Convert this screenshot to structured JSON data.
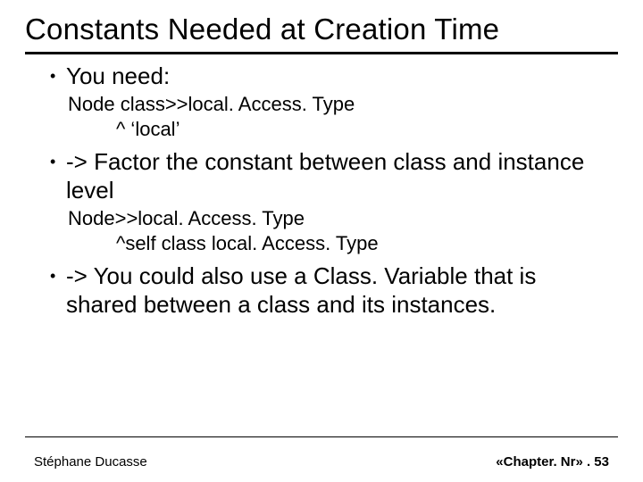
{
  "title": "Constants Needed at Creation Time",
  "bullets": {
    "b1": "You need:",
    "code1_l1": "Node class>>local. Access. Type",
    "code1_l2": "^ ‘local’",
    "b2": "-> Factor the constant between class and instance level",
    "code2_l1": "Node>>local. Access. Type",
    "code2_l2": "^self class local. Access. Type",
    "b3": "-> You could also use a Class. Variable that is shared between a class and its instances."
  },
  "footer": {
    "author": "Stéphane Ducasse",
    "pageref": "«Chapter. Nr» . 53"
  }
}
